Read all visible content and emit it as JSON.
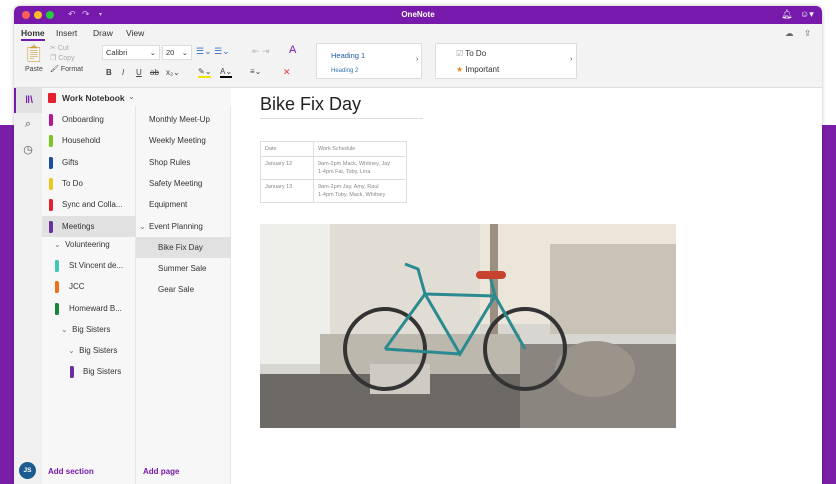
{
  "app": {
    "title": "OneNote"
  },
  "ribbon": {
    "tabs": [
      "Home",
      "Insert",
      "Draw",
      "View"
    ],
    "paste": "Paste",
    "cut": "Cut",
    "copy": "Copy",
    "format": "Format",
    "font": "Calibri",
    "size": "20",
    "styles": [
      "Heading 1",
      "Heading 2"
    ],
    "tags": [
      "To Do",
      "Important"
    ]
  },
  "notebook": {
    "name": "Work Notebook"
  },
  "sections": [
    {
      "label": "Onboarding",
      "color": "#b4169a"
    },
    {
      "label": "Household",
      "color": "#7cc522"
    },
    {
      "label": "Gifts",
      "color": "#1a4fa0"
    },
    {
      "label": "To Do",
      "color": "#f2c31a"
    },
    {
      "label": "Sync and Colla...",
      "color": "#e3202e"
    },
    {
      "label": "Meetings",
      "color": "#6b2fa0"
    }
  ],
  "group": {
    "label": "Volunteering",
    "children": [
      {
        "label": "St Vincent de...",
        "color": "#3cc7b8"
      },
      {
        "label": "JCC",
        "color": "#ee6f1c"
      },
      {
        "label": "Homeward B...",
        "color": "#17843c"
      }
    ]
  },
  "big_sisters": {
    "group1": "Big Sisters",
    "group2": "Big Sisters",
    "section": "Big Sisters",
    "color": "#6b2fa0"
  },
  "pages": [
    "Monthly Meet-Up",
    "Weekly Meeting",
    "Shop Rules",
    "Safety Meeting",
    "Equipment",
    "Event Planning",
    "Bike Fix Day",
    "Summer Sale",
    "Gear Sale"
  ],
  "footer": {
    "avatar": "JS",
    "add_section": "Add section",
    "add_page": "Add page"
  },
  "page": {
    "title": "Bike Fix Day",
    "table": {
      "headers": [
        "Date",
        "Work Schedule"
      ],
      "rows": [
        [
          "January 12",
          "9am-2pm Mack, Whitney, Jay",
          "1-4pm Fai, Toby, Lina"
        ],
        [
          "January 13",
          "9am-2pm Jay, Amy, Raul",
          "1-4pm Toby, Mack, Whitney"
        ]
      ]
    }
  },
  "colors": {
    "brand": "#7719aa"
  }
}
